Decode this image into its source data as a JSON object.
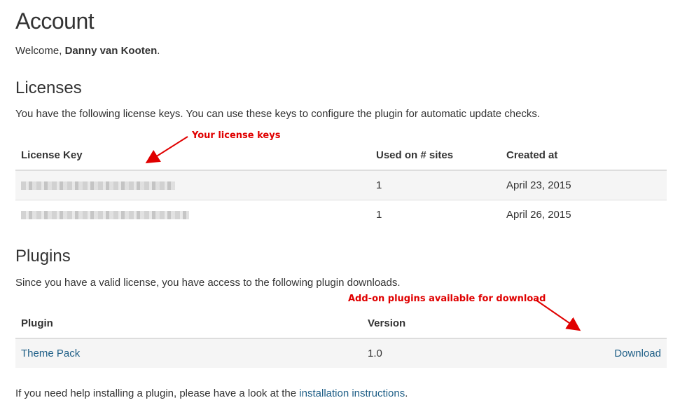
{
  "title": "Account",
  "welcome": {
    "prefix": "Welcome, ",
    "name": "Danny van Kooten",
    "suffix": "."
  },
  "licenses": {
    "heading": "Licenses",
    "intro": "You have the following license keys. You can use these keys to configure the plugin for automatic update checks.",
    "columns": [
      "License Key",
      "Used on # sites",
      "Created at"
    ],
    "rows": [
      {
        "key": "",
        "sites": "1",
        "created": "April 23, 2015"
      },
      {
        "key": "",
        "sites": "1",
        "created": "April 26, 2015"
      }
    ],
    "annotation": "Your license keys"
  },
  "plugins": {
    "heading": "Plugins",
    "intro": "Since you have a valid license, you have access to the following plugin downloads.",
    "columns": [
      "Plugin",
      "Version"
    ],
    "rows": [
      {
        "name": "Theme Pack",
        "version": "1.0",
        "download": "Download"
      }
    ],
    "annotation": "Add-on plugins available for download"
  },
  "footer": {
    "prefix": "If you need help installing a plugin, please have a look at the ",
    "link": "installation instructions",
    "suffix": "."
  },
  "colors": {
    "link": "#1f5f87",
    "annotation": "#e00000",
    "stripe": "#f5f5f5",
    "border": "#dddddd"
  }
}
